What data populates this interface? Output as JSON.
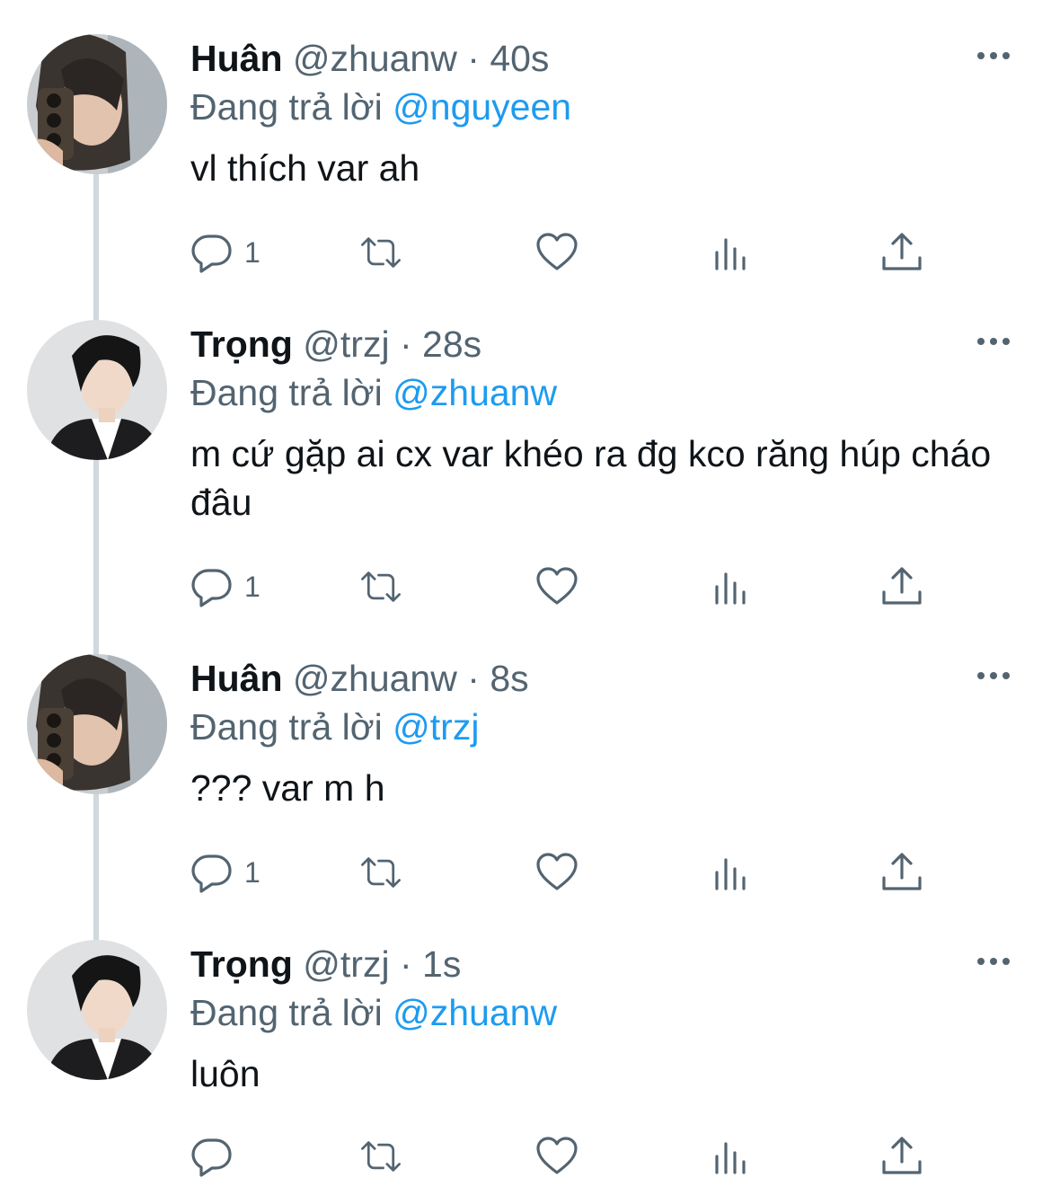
{
  "colors": {
    "text": "#0f1419",
    "secondary": "#536471",
    "mention": "#1d9bf0",
    "thread_line": "#cfd9de"
  },
  "tweets": [
    {
      "name": "Huân",
      "handle": "@zhuanw",
      "sep": "·",
      "time": "40s",
      "reply_prefix": "Đang trả lời",
      "reply_to": "@nguyeen",
      "text": "vl thích var ah",
      "reply_count": "1",
      "avatar": "huan-avatar-icon"
    },
    {
      "name": "Trọng",
      "handle": "@trzj",
      "sep": "·",
      "time": "28s",
      "reply_prefix": "Đang trả lời",
      "reply_to": "@zhuanw",
      "text": "m cứ gặp ai cx var khéo ra đg kco răng húp cháo đâu",
      "reply_count": "1",
      "avatar": "trong-avatar-icon"
    },
    {
      "name": "Huân",
      "handle": "@zhuanw",
      "sep": "·",
      "time": "8s",
      "reply_prefix": "Đang trả lời",
      "reply_to": "@trzj",
      "text": "??? var m h",
      "reply_count": "1",
      "avatar": "huan-avatar-icon"
    },
    {
      "name": "Trọng",
      "handle": "@trzj",
      "sep": "·",
      "time": "1s",
      "reply_prefix": "Đang trả lời",
      "reply_to": "@zhuanw",
      "text": "luôn",
      "reply_count": "",
      "avatar": "trong-avatar-icon"
    }
  ],
  "icons": [
    "reply-icon",
    "retweet-icon",
    "like-icon",
    "analytics-icon",
    "share-icon",
    "more-icon"
  ]
}
